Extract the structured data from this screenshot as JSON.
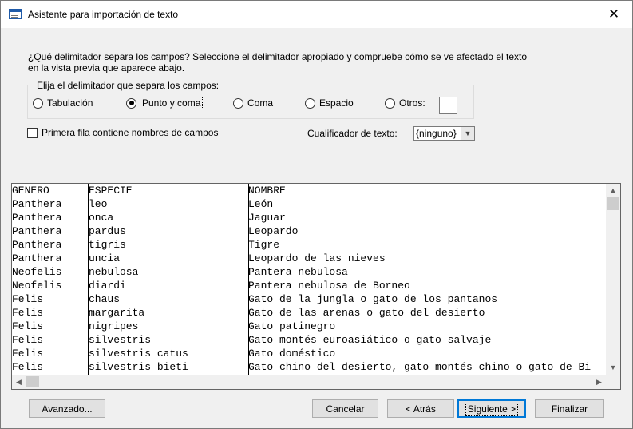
{
  "window": {
    "title": "Asistente para importación de texto",
    "close_glyph": "✕"
  },
  "instructions": "¿Qué delimitador separa los campos? Seleccione el delimitador apropiado y compruebe cómo se ve afectado el texto en la vista previa que aparece abajo.",
  "delimiter_group": {
    "legend": "Elija el delimitador que separa los campos:",
    "options": [
      {
        "label": "Tabulación",
        "selected": false
      },
      {
        "label": "Punto y coma",
        "selected": true
      },
      {
        "label": "Coma",
        "selected": false
      },
      {
        "label": "Espacio",
        "selected": false
      },
      {
        "label": "Otros:",
        "selected": false
      }
    ],
    "other_value": ""
  },
  "first_row_names": {
    "label": "Primera fila contiene nombres de campos",
    "checked": false
  },
  "text_qualifier": {
    "label": "Cualificador de texto:",
    "value": "{ninguno}"
  },
  "preview": {
    "rows": [
      [
        "GENERO",
        "ESPECIE",
        "NOMBRE"
      ],
      [
        "Panthera",
        "leo",
        "León"
      ],
      [
        "Panthera",
        "onca",
        "Jaguar"
      ],
      [
        "Panthera",
        "pardus",
        "Leopardo"
      ],
      [
        "Panthera",
        "tigris",
        "Tigre"
      ],
      [
        "Panthera",
        "uncia",
        "Leopardo de las nieves"
      ],
      [
        "Neofelis",
        "nebulosa",
        "Pantera nebulosa"
      ],
      [
        "Neofelis",
        "diardi",
        "Pantera nebulosa de Borneo"
      ],
      [
        "Felis",
        "chaus",
        "Gato de la jungla o gato de los pantanos"
      ],
      [
        "Felis",
        "margarita",
        "Gato de las arenas o gato del desierto"
      ],
      [
        "Felis",
        "nigripes",
        "Gato patinegro"
      ],
      [
        "Felis",
        "silvestris",
        "Gato montés euroasiático o gato salvaje"
      ],
      [
        "Felis",
        "silvestris catus",
        "Gato doméstico"
      ],
      [
        "Felis",
        "silvestris bieti",
        "Gato chino del desierto, gato montés chino o gato de Bi"
      ]
    ]
  },
  "buttons": {
    "advanced": "Avanzado...",
    "cancel": "Cancelar",
    "back": "< Atrás",
    "next": "Siguiente >",
    "finish": "Finalizar"
  }
}
